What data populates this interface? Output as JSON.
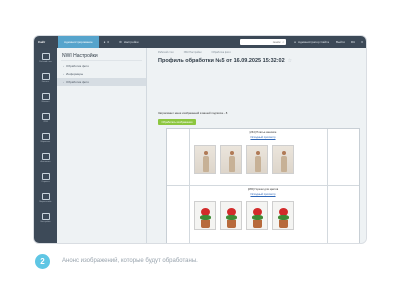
{
  "topbar": {
    "brand": "Сайт",
    "active_tab": "Администрирование",
    "bell_count": "0",
    "settings_label": "Настройки",
    "search_placeholder": "поиск",
    "user_label": "Администратор Сайта",
    "exit_label": "Выйти",
    "lang_label": "RU"
  },
  "sidebar": {
    "items": [
      {
        "icon": "desktop-icon",
        "label": "Рабочий стол"
      },
      {
        "icon": "content-icon",
        "label": "Контент"
      },
      {
        "icon": "store-icon",
        "label": "Магазин"
      },
      {
        "icon": "crm-icon",
        "label": "CRM"
      },
      {
        "icon": "marketing-icon",
        "label": "Маркетинг"
      },
      {
        "icon": "analytics-icon",
        "label": "Аналитика"
      },
      {
        "icon": "services-icon",
        "label": "Сервисы"
      },
      {
        "icon": "market-icon",
        "label": "Маркетплейс"
      },
      {
        "icon": "settings-icon",
        "label": "Настройки"
      }
    ]
  },
  "panel": {
    "title": "NWI Настройки",
    "items": [
      {
        "label": "Обработка фото"
      },
      {
        "label": "Информеры"
      },
      {
        "label": "Обработка фото"
      }
    ]
  },
  "main": {
    "breadcrumbs": [
      "Рабочий стол",
      "NWI Настройки",
      "Обработка фото"
    ],
    "title": "Профиль обработки №5 от 16.09.2025 15:32:02",
    "intro": "Затрагивает меня изображений в вашей подписке - 8",
    "go_button": "Обработать изображения",
    "blocks": [
      {
        "title": "[264] Платье женское",
        "link": "Исходный просмотр"
      },
      {
        "title": "[265] Горшки для цветов",
        "link": "Исходный просмотр"
      }
    ]
  },
  "caption": {
    "number": "2",
    "text": "Анонс изображений, которые будут обработаны."
  }
}
